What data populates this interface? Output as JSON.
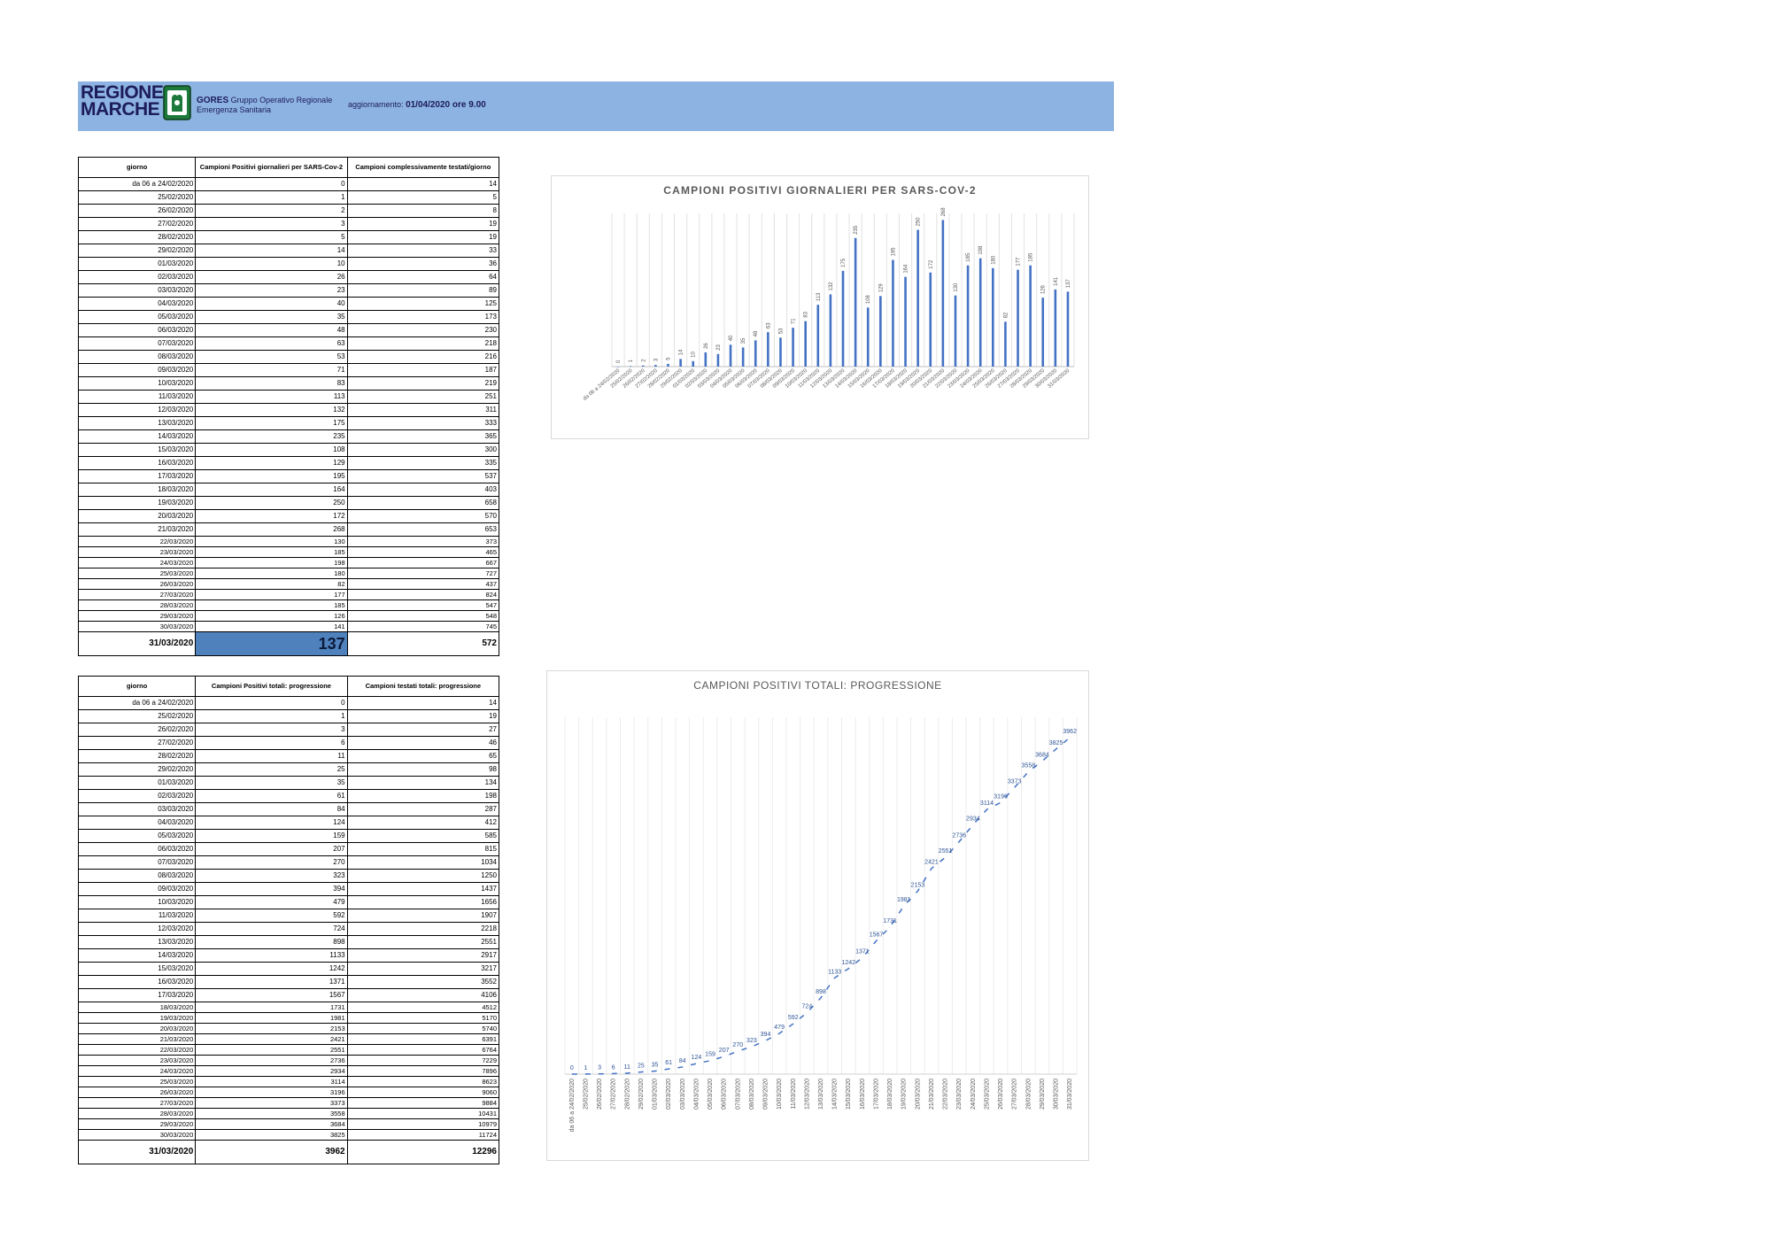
{
  "header": {
    "logo_line1": "REGIONE",
    "logo_line2": "MARCHE",
    "org_bold": "GORES",
    "org_rest": " Gruppo Operativo Regionale",
    "org_line2": "Emergenza Sanitaria",
    "update_label": "aggiornamento:",
    "update_value": "01/04/2020 ore 9.00",
    "banner_color": "#8db3e2"
  },
  "table1": {
    "headers": [
      "giorno",
      "Campioni Positivi giornalieri per SARS-Cov-2",
      "Campioni complessivamente testati/giorno"
    ],
    "rows": [
      [
        "da 06 a 24/02/2020",
        "0",
        "14"
      ],
      [
        "25/02/2020",
        "1",
        "5"
      ],
      [
        "26/02/2020",
        "2",
        "8"
      ],
      [
        "27/02/2020",
        "3",
        "19"
      ],
      [
        "28/02/2020",
        "5",
        "19"
      ],
      [
        "29/02/2020",
        "14",
        "33"
      ],
      [
        "01/03/2020",
        "10",
        "36"
      ],
      [
        "02/03/2020",
        "26",
        "64"
      ],
      [
        "03/03/2020",
        "23",
        "89"
      ],
      [
        "04/03/2020",
        "40",
        "125"
      ],
      [
        "05/03/2020",
        "35",
        "173"
      ],
      [
        "06/03/2020",
        "48",
        "230"
      ],
      [
        "07/03/2020",
        "63",
        "218"
      ],
      [
        "08/03/2020",
        "53",
        "216"
      ],
      [
        "09/03/2020",
        "71",
        "187"
      ],
      [
        "10/03/2020",
        "83",
        "219"
      ],
      [
        "11/03/2020",
        "113",
        "251"
      ],
      [
        "12/03/2020",
        "132",
        "311"
      ],
      [
        "13/03/2020",
        "175",
        "333"
      ],
      [
        "14/03/2020",
        "235",
        "365"
      ],
      [
        "15/03/2020",
        "108",
        "300"
      ],
      [
        "16/03/2020",
        "129",
        "335"
      ],
      [
        "17/03/2020",
        "195",
        "537"
      ],
      [
        "18/03/2020",
        "164",
        "403"
      ],
      [
        "19/03/2020",
        "250",
        "658"
      ],
      [
        "20/03/2020",
        "172",
        "570"
      ],
      [
        "21/03/2020",
        "268",
        "653"
      ],
      [
        "22/03/2020",
        "130",
        "373"
      ],
      [
        "23/03/2020",
        "185",
        "465"
      ],
      [
        "24/03/2020",
        "198",
        "667"
      ],
      [
        "25/03/2020",
        "180",
        "727"
      ],
      [
        "26/03/2020",
        "82",
        "437"
      ],
      [
        "27/03/2020",
        "177",
        "824"
      ],
      [
        "28/03/2020",
        "185",
        "547"
      ],
      [
        "29/03/2020",
        "126",
        "548"
      ],
      [
        "30/03/2020",
        "141",
        "745"
      ]
    ],
    "last_row": [
      "31/03/2020",
      "137",
      "572"
    ],
    "highlight_color": "#4f81bd"
  },
  "table2": {
    "headers": [
      "giorno",
      "Campioni Positivi totali: progressione",
      "Campioni testati totali: progressione"
    ],
    "rows": [
      [
        "da 06 a 24/02/2020",
        "0",
        "14"
      ],
      [
        "25/02/2020",
        "1",
        "19"
      ],
      [
        "26/02/2020",
        "3",
        "27"
      ],
      [
        "27/02/2020",
        "6",
        "46"
      ],
      [
        "28/02/2020",
        "11",
        "65"
      ],
      [
        "29/02/2020",
        "25",
        "98"
      ],
      [
        "01/03/2020",
        "35",
        "134"
      ],
      [
        "02/03/2020",
        "61",
        "198"
      ],
      [
        "03/03/2020",
        "84",
        "287"
      ],
      [
        "04/03/2020",
        "124",
        "412"
      ],
      [
        "05/03/2020",
        "159",
        "585"
      ],
      [
        "06/03/2020",
        "207",
        "815"
      ],
      [
        "07/03/2020",
        "270",
        "1034"
      ],
      [
        "08/03/2020",
        "323",
        "1250"
      ],
      [
        "09/03/2020",
        "394",
        "1437"
      ],
      [
        "10/03/2020",
        "479",
        "1656"
      ],
      [
        "11/03/2020",
        "592",
        "1907"
      ],
      [
        "12/03/2020",
        "724",
        "2218"
      ],
      [
        "13/03/2020",
        "898",
        "2551"
      ],
      [
        "14/03/2020",
        "1133",
        "2917"
      ],
      [
        "15/03/2020",
        "1242",
        "3217"
      ],
      [
        "16/03/2020",
        "1371",
        "3552"
      ],
      [
        "17/03/2020",
        "1567",
        "4106"
      ],
      [
        "18/03/2020",
        "1731",
        "4512"
      ],
      [
        "19/03/2020",
        "1981",
        "5170"
      ],
      [
        "20/03/2020",
        "2153",
        "5740"
      ],
      [
        "21/03/2020",
        "2421",
        "6391"
      ],
      [
        "22/03/2020",
        "2551",
        "6764"
      ],
      [
        "23/03/2020",
        "2736",
        "7229"
      ],
      [
        "24/03/2020",
        "2934",
        "7896"
      ],
      [
        "25/03/2020",
        "3114",
        "8623"
      ],
      [
        "26/03/2020",
        "3196",
        "9060"
      ],
      [
        "27/03/2020",
        "3373",
        "9884"
      ],
      [
        "28/03/2020",
        "3558",
        "10431"
      ],
      [
        "29/03/2020",
        "3684",
        "10979"
      ],
      [
        "30/03/2020",
        "3825",
        "11724"
      ]
    ],
    "last_row": [
      "31/03/2020",
      "3962",
      "12296"
    ]
  },
  "chart_data": [
    {
      "type": "bar",
      "title": "CAMPIONI POSITIVI GIORNALIERI PER SARS-COV-2",
      "categories": [
        "da 06 a 24/02/2020",
        "25/02/2020",
        "26/02/2020",
        "27/02/2020",
        "28/02/2020",
        "29/02/2020",
        "01/03/2020",
        "02/03/2020",
        "03/03/2020",
        "04/03/2020",
        "05/03/2020",
        "06/03/2020",
        "07/03/2020",
        "08/03/2020",
        "09/03/2020",
        "10/03/2020",
        "11/03/2020",
        "12/03/2020",
        "13/03/2020",
        "14/03/2020",
        "15/03/2020",
        "16/03/2020",
        "17/03/2020",
        "18/03/2020",
        "19/03/2020",
        "20/03/2020",
        "21/03/2020",
        "22/03/2020",
        "23/03/2020",
        "24/03/2020",
        "25/03/2020",
        "26/03/2020",
        "27/03/2020",
        "28/03/2020",
        "29/03/2020",
        "30/03/2020",
        "31/03/2020"
      ],
      "values": [
        0,
        1,
        2,
        3,
        5,
        14,
        10,
        26,
        23,
        40,
        35,
        48,
        63,
        53,
        71,
        83,
        113,
        132,
        175,
        235,
        108,
        129,
        195,
        164,
        250,
        172,
        268,
        130,
        185,
        198,
        180,
        82,
        177,
        185,
        126,
        141,
        137
      ],
      "ylim": [
        0,
        280
      ],
      "grid": "vertical",
      "color": "#4472c4"
    },
    {
      "type": "line",
      "title": "CAMPIONI POSITIVI TOTALI: PROGRESSIONE",
      "categories": [
        "da 06 a 24/02/2020",
        "25/02/2020",
        "26/02/2020",
        "27/02/2020",
        "28/02/2020",
        "29/02/2020",
        "01/03/2020",
        "02/03/2020",
        "03/03/2020",
        "04/03/2020",
        "05/03/2020",
        "06/03/2020",
        "07/03/2020",
        "08/03/2020",
        "09/03/2020",
        "10/03/2020",
        "11/03/2020",
        "12/03/2020",
        "13/03/2020",
        "14/03/2020",
        "15/03/2020",
        "16/03/2020",
        "17/03/2020",
        "18/03/2020",
        "19/03/2020",
        "20/03/2020",
        "21/03/2020",
        "22/03/2020",
        "23/03/2020",
        "24/03/2020",
        "25/03/2020",
        "26/03/2020",
        "27/03/2020",
        "28/03/2020",
        "29/03/2020",
        "30/03/2020",
        "31/03/2020"
      ],
      "values": [
        0,
        1,
        3,
        6,
        11,
        25,
        35,
        61,
        84,
        124,
        159,
        207,
        270,
        323,
        394,
        479,
        592,
        724,
        898,
        1133,
        1242,
        1371,
        1567,
        1731,
        1981,
        2153,
        2421,
        2551,
        2736,
        2934,
        3114,
        3196,
        3373,
        3558,
        3684,
        3825,
        3962
      ],
      "ylim": [
        0,
        4200
      ],
      "grid": "vertical",
      "color": "#4472c4"
    }
  ]
}
